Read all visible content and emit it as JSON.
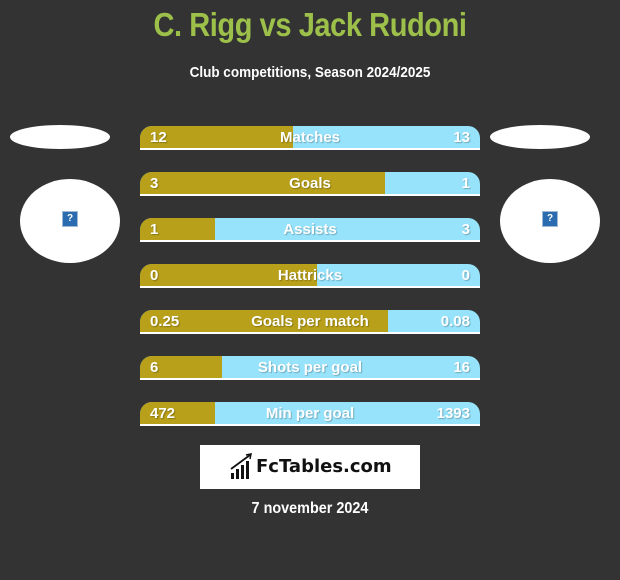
{
  "header": {
    "title": "C. Rigg vs Jack Rudoni",
    "subtitle": "Club competitions, Season 2024/2025"
  },
  "players": {
    "left": {
      "name": "C. Rigg",
      "image_icon": "broken-image-icon",
      "image_glyph": "?"
    },
    "right": {
      "name": "Jack Rudoni",
      "image_icon": "broken-image-icon",
      "image_glyph": "?"
    }
  },
  "colors": {
    "background": "#333333",
    "title": "#9dc04a",
    "left_bar": "#b8a01a",
    "right_bar": "#97e3fb"
  },
  "stats": [
    {
      "label": "Matches",
      "left": "12",
      "right": "13",
      "left_share": 0.45
    },
    {
      "label": "Goals",
      "left": "3",
      "right": "1",
      "left_share": 0.72
    },
    {
      "label": "Assists",
      "left": "1",
      "right": "3",
      "left_share": 0.22
    },
    {
      "label": "Hattricks",
      "left": "0",
      "right": "0",
      "left_share": 0.52
    },
    {
      "label": "Goals per match",
      "left": "0.25",
      "right": "0.08",
      "left_share": 0.73
    },
    {
      "label": "Shots per goal",
      "left": "6",
      "right": "16",
      "left_share": 0.24
    },
    {
      "label": "Min per goal",
      "left": "472",
      "right": "1393",
      "left_share": 0.22
    }
  ],
  "footer": {
    "logo_text": "FcTables.com",
    "logo_icon": "bar-chart-growth-icon",
    "date": "7 november 2024"
  }
}
